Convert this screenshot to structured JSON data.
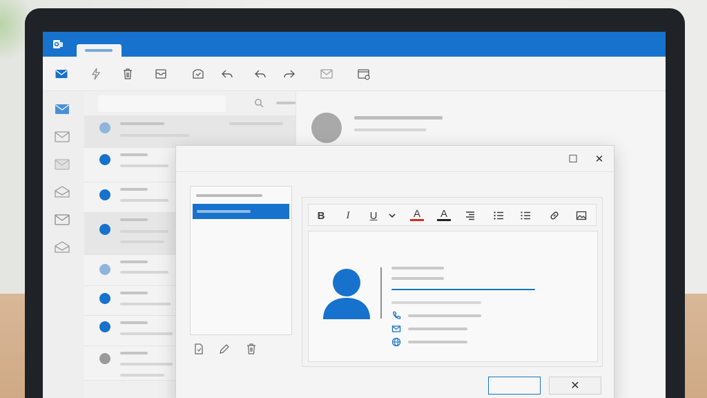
{
  "app": {
    "name": "Outlook"
  },
  "colors": {
    "accent": "#1672cc",
    "unread": "#1672cc",
    "read": "#8fb5dc",
    "muted": "#9a9a9a"
  },
  "ribbon": {
    "icons": [
      "mail-icon",
      "lightning-icon",
      "trash-icon",
      "archive-icon",
      "sweep-icon",
      "reply-icon",
      "reply-all-icon",
      "forward-icon",
      "mark-unread-icon",
      "rules-icon"
    ]
  },
  "leftnav": {
    "icons": [
      "inbox-icon",
      "drafts-icon",
      "sent-icon",
      "archive-folder-icon",
      "junk-icon",
      "deleted-icon"
    ]
  },
  "message_list": {
    "rows": [
      {
        "state": "read",
        "selected": true
      },
      {
        "state": "unread",
        "selected": false
      },
      {
        "state": "unread",
        "selected": false
      },
      {
        "state": "unread",
        "selected": true
      },
      {
        "state": "read",
        "selected": false
      },
      {
        "state": "unread",
        "selected": false
      },
      {
        "state": "unread",
        "selected": false
      },
      {
        "state": "seen",
        "selected": false
      }
    ]
  },
  "dialog": {
    "maximize_glyph": "☐",
    "close_glyph": "✕",
    "cancel_glyph": "✕",
    "formatting": {
      "bold": "B",
      "italic": "I",
      "underline": "U",
      "font_color": "A",
      "highlight": "A"
    }
  }
}
